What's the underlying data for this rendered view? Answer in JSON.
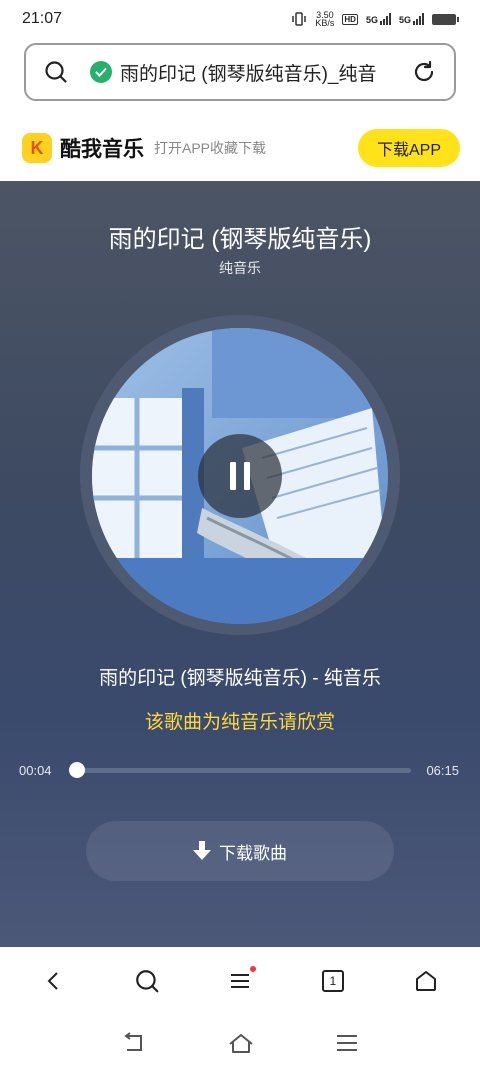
{
  "status_bar": {
    "time": "21:07",
    "net_speed": "3.50\nKB/s",
    "hd_label": "HD",
    "net1": "5G",
    "net2": "5G"
  },
  "url_bar": {
    "url_text": "雨的印记 (钢琴版纯音乐)_纯音"
  },
  "banner": {
    "logo_letter": "K",
    "app_name": "酷我音乐",
    "promo_text": "打开APP收藏下载",
    "download_app_label": "下载APP",
    "accent_color": "#ffe21a"
  },
  "player": {
    "song_title": "雨的印记 (钢琴版纯音乐)",
    "artist": "纯音乐",
    "song_line": "雨的印记 (钢琴版纯音乐) - 纯音乐",
    "pure_music_note": "该歌曲为纯音乐请欣赏",
    "current_time": "00:04",
    "total_time": "06:15",
    "progress_fraction": 0.011,
    "download_song_label": "下载歌曲"
  },
  "browser_nav": {
    "tab_count": "1"
  }
}
